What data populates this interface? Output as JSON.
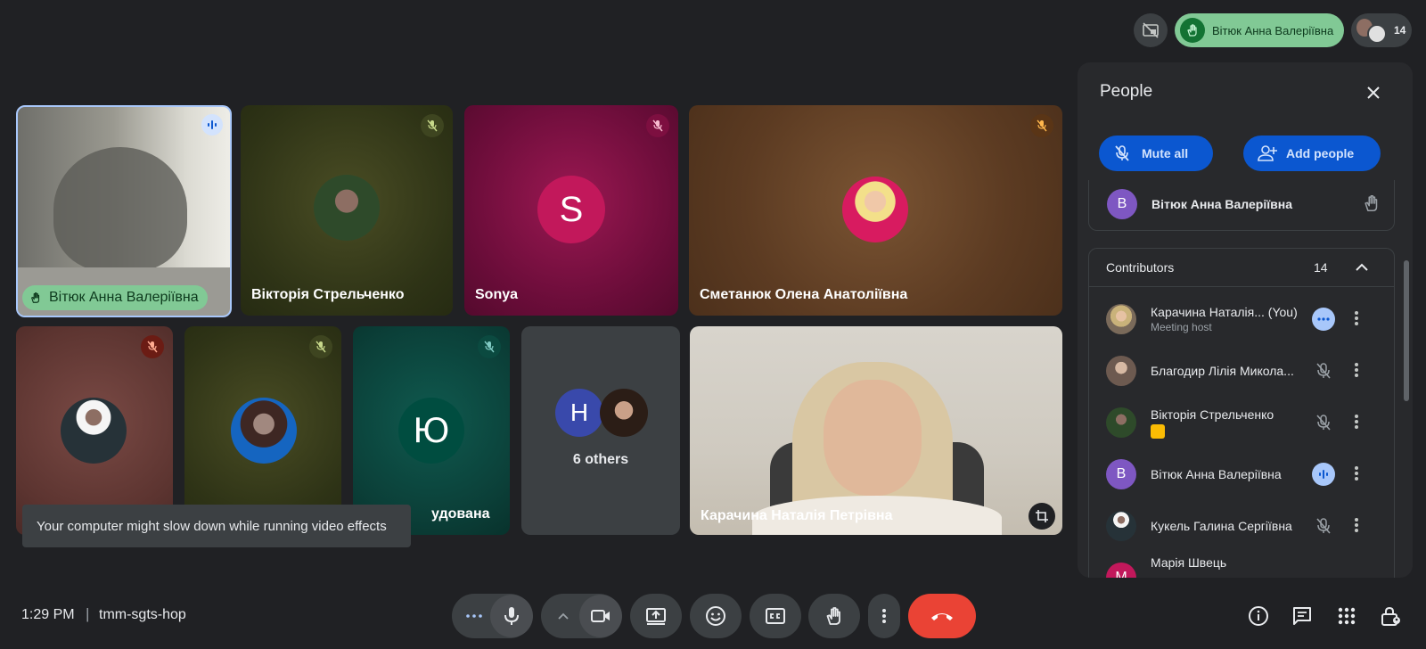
{
  "top": {
    "raised_hand_name": "Вітюк Анна Валеріївна",
    "participant_count": "14"
  },
  "tiles": {
    "t1": "Вітюк Анна Валеріївна",
    "t2": "Вікторія Стрельченко",
    "t3": "Sonya",
    "t3_letter": "S",
    "t4": "Сметанюк Олена Анатоліївна",
    "t7": "удована",
    "t7_letter": "Ю",
    "t8_letter": "H",
    "t8": "6 others",
    "t9": "Карачина Наталія Петрівна"
  },
  "toast": "Your computer might slow down while running video effects",
  "people": {
    "title": "People",
    "mute_all": "Mute all",
    "add_people": "Add people",
    "raised": {
      "letter": "B",
      "name": "Вітюк Анна Валеріївна"
    },
    "section_title": "Contributors",
    "section_count": "14",
    "rows": [
      {
        "name": "Карачина Наталія... (You)",
        "sub": "Meeting host"
      },
      {
        "name": "Благодир Лілія Микола..."
      },
      {
        "name": "Вікторія Стрельченко"
      },
      {
        "name": "Вітюк Анна Валеріївна",
        "letter": "B"
      },
      {
        "name": "Кукель Галина Сергіївна"
      },
      {
        "name": "Марія Швець",
        "letter": "M"
      }
    ]
  },
  "bottom": {
    "time": "1:29 PM",
    "separator": "|",
    "meeting_code": "tmm-sgts-hop"
  }
}
